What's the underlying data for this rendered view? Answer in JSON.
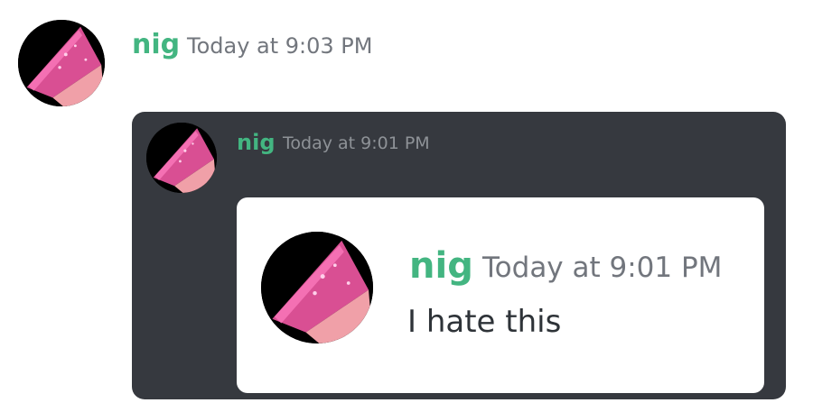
{
  "outer_message": {
    "username": "nig",
    "timestamp": "Today at 9:03 PM",
    "avatar_icon": "pink-glitter-avatar"
  },
  "quoted_card": {
    "username": "nig",
    "timestamp": "Today at 9:01 PM",
    "avatar_icon": "pink-glitter-avatar"
  },
  "nested_card": {
    "username": "nig",
    "timestamp": "Today at 9:01 PM",
    "message": "I hate this",
    "avatar_icon": "pink-glitter-avatar"
  },
  "colors": {
    "username": "#43b581",
    "timestamp": "#72767d",
    "dark_card": "#36393f",
    "message_text": "#2e3338",
    "avatar_pink": "#e05a9a"
  }
}
